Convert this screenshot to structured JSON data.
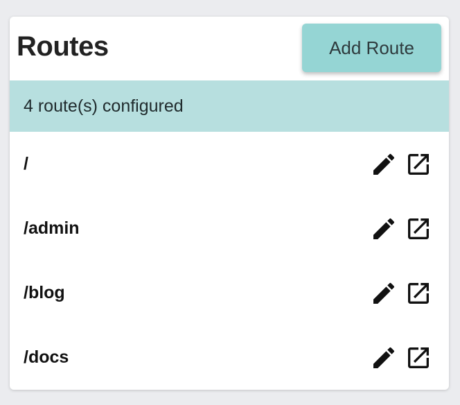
{
  "header": {
    "title": "Routes",
    "add_button_label": "Add Route"
  },
  "status": {
    "text": "4 route(s) configured"
  },
  "routes": [
    {
      "path": "/",
      "actions": [
        "edit-icon",
        "open-external-icon"
      ]
    },
    {
      "path": "/admin",
      "actions": [
        "edit-icon",
        "open-external-icon"
      ]
    },
    {
      "path": "/blog",
      "actions": [
        "edit-icon",
        "open-external-icon"
      ]
    },
    {
      "path": "/docs",
      "actions": [
        "edit-icon",
        "open-external-icon"
      ]
    }
  ],
  "colors": {
    "background": "#ebecef",
    "accent_button": "#95d5d4",
    "status_bar": "#b7dfdf",
    "text_dark": "#222222"
  }
}
